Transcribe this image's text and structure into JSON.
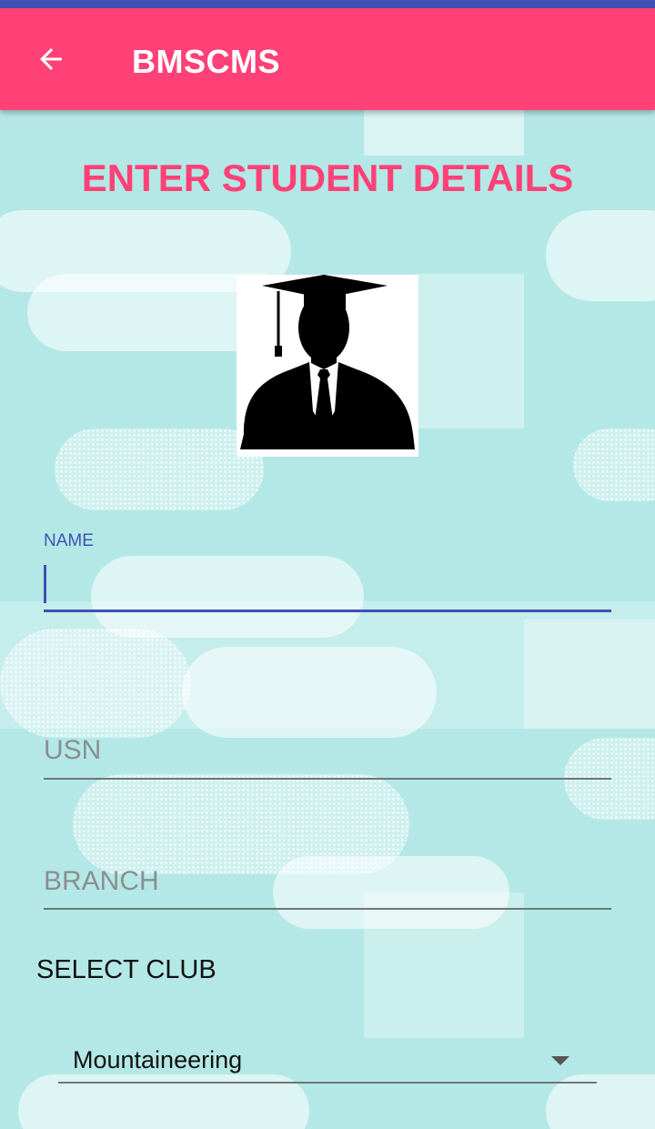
{
  "app_bar": {
    "title": "BMSCMS",
    "back_icon": "arrow-left-icon",
    "color": "#ff4177"
  },
  "status_bar_color": "#3f51b5",
  "form": {
    "heading": "ENTER STUDENT DETAILS",
    "avatar_icon": "graduate-avatar-icon",
    "name": {
      "label": "NAME",
      "value": ""
    },
    "usn": {
      "placeholder": "USN",
      "value": ""
    },
    "branch": {
      "placeholder": "BRANCH",
      "value": ""
    },
    "club": {
      "label": "SELECT CLUB",
      "selected": "Mountaineering",
      "dropdown_icon": "dropdown-arrow-icon"
    }
  },
  "colors": {
    "accent": "#3f51b5",
    "heading": "#ff4177",
    "background": "#b4e8e6"
  }
}
